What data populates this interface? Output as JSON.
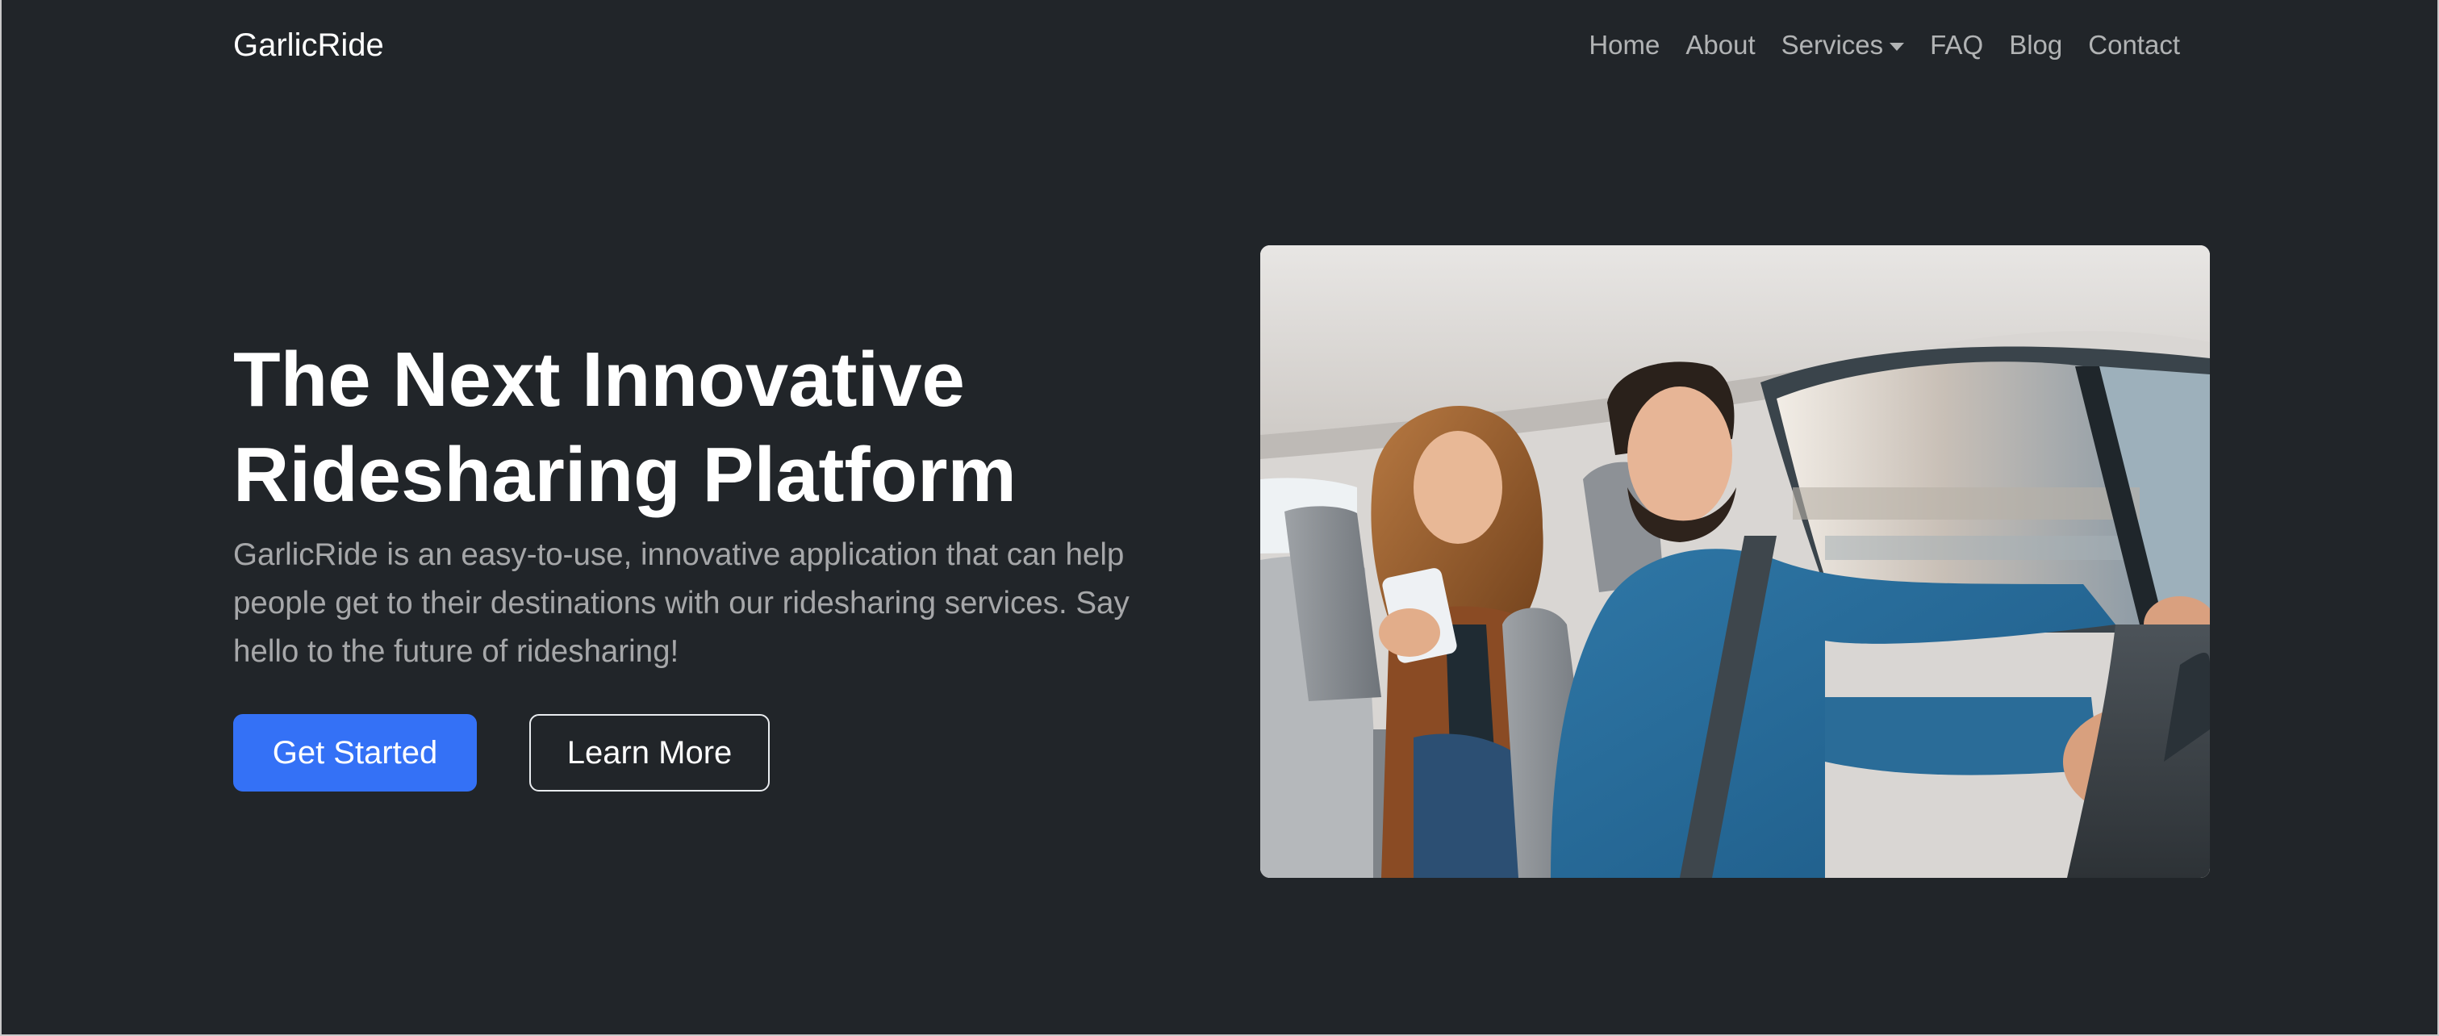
{
  "navbar": {
    "brand": "GarlicRide",
    "links": [
      {
        "label": "Home"
      },
      {
        "label": "About"
      },
      {
        "label": "Services",
        "has_dropdown": true
      },
      {
        "label": "FAQ"
      },
      {
        "label": "Blog"
      },
      {
        "label": "Contact"
      }
    ]
  },
  "hero": {
    "title_line1": "The Next Innovative",
    "title_line2": "Ridesharing Platform",
    "lead": "GarlicRide is an easy-to-use, innovative application that can help people get to their destinations with our ridesharing services. Say hello to the future of ridesharing!",
    "primary_button": "Get Started",
    "secondary_button": "Learn More"
  },
  "colors": {
    "background": "#212529",
    "primary": "#3471f6",
    "text_light": "#ffffff",
    "text_muted": "rgba(255,255,255,0.6)"
  },
  "icons": {
    "services_dropdown": "caret-down-icon"
  }
}
